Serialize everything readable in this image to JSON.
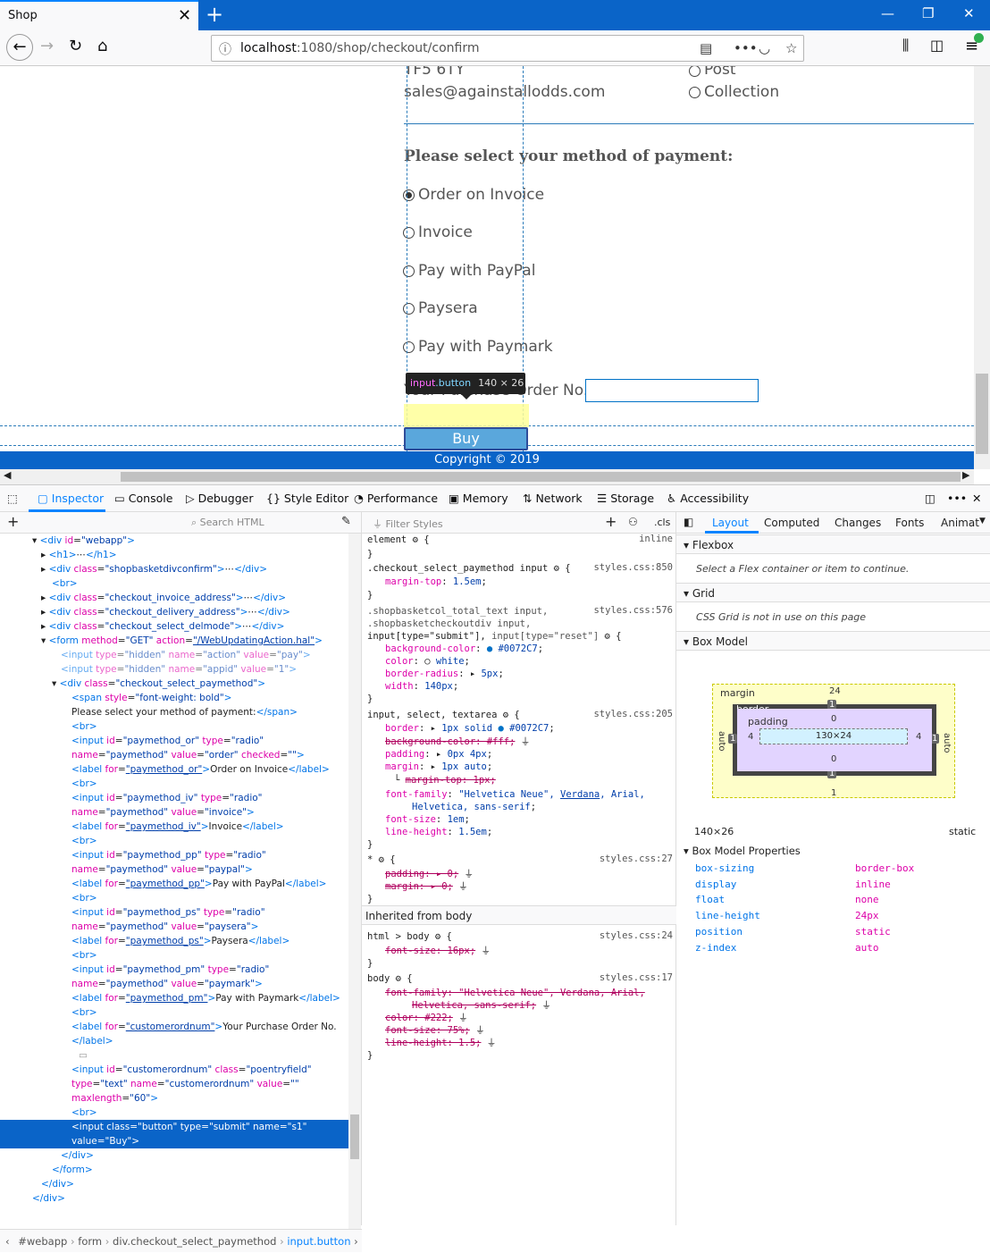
{
  "browser": {
    "tab_title": "Shop",
    "url_host": "localhost",
    "url_path": ":1080/shop/checkout/confirm"
  },
  "page": {
    "addr_line1": "TF5 6TY",
    "addr_line2": "sales@againstallodds.com",
    "delivery": [
      "Post",
      "Collection"
    ],
    "payment_heading": "Please select your method of payment:",
    "payment_options": [
      {
        "label": "Order on Invoice",
        "checked": true
      },
      {
        "label": "Invoice",
        "checked": false
      },
      {
        "label": "Pay with PayPal",
        "checked": false
      },
      {
        "label": "Paysera",
        "checked": false
      },
      {
        "label": "Pay with Paymark",
        "checked": false
      }
    ],
    "purchase_order_label": "Your Purchase Order No.",
    "purchase_order_value": "",
    "buy_label": "Buy",
    "footer": "Copyright © 2019",
    "tooltip": {
      "el": "input",
      "cls": ".button",
      "size": "140 × 26"
    }
  },
  "devtools": {
    "tabs": [
      "Inspector",
      "Console",
      "Debugger",
      "Style Editor",
      "Performance",
      "Memory",
      "Network",
      "Storage",
      "Accessibility"
    ],
    "search_html": "Search HTML",
    "filter_styles": "Filter Styles",
    "cls": ".cls",
    "right_tabs": [
      "Layout",
      "Computed",
      "Changes",
      "Fonts",
      "Animat"
    ],
    "flexbox": "Flexbox",
    "flexbox_msg": "Select a Flex container or item to continue.",
    "grid": "Grid",
    "grid_msg": "CSS Grid is not in use on this page",
    "boxmodel": "Box Model",
    "bm": {
      "margin": "margin",
      "border": "border",
      "padding": "padding",
      "content": "130×24",
      "mt": "24",
      "mb": "1",
      "ml": "auto",
      "mr": "auto",
      "bt": "1",
      "bb": "1",
      "bl": "1",
      "br": "1",
      "pt": "0",
      "pb": "0",
      "pl": "4",
      "pr": "4"
    },
    "dims": "140×26",
    "position_text": "static",
    "bmprops_title": "Box Model Properties",
    "bmprops": [
      [
        "box-sizing",
        "border-box"
      ],
      [
        "display",
        "inline"
      ],
      [
        "float",
        "none"
      ],
      [
        "line-height",
        "24px"
      ],
      [
        "position",
        "static"
      ],
      [
        "z-index",
        "auto"
      ]
    ],
    "breadcrumbs": [
      "#webapp",
      "form",
      "div.checkout_select_paymethod",
      "input.button"
    ],
    "inherited": "Inherited from body"
  }
}
